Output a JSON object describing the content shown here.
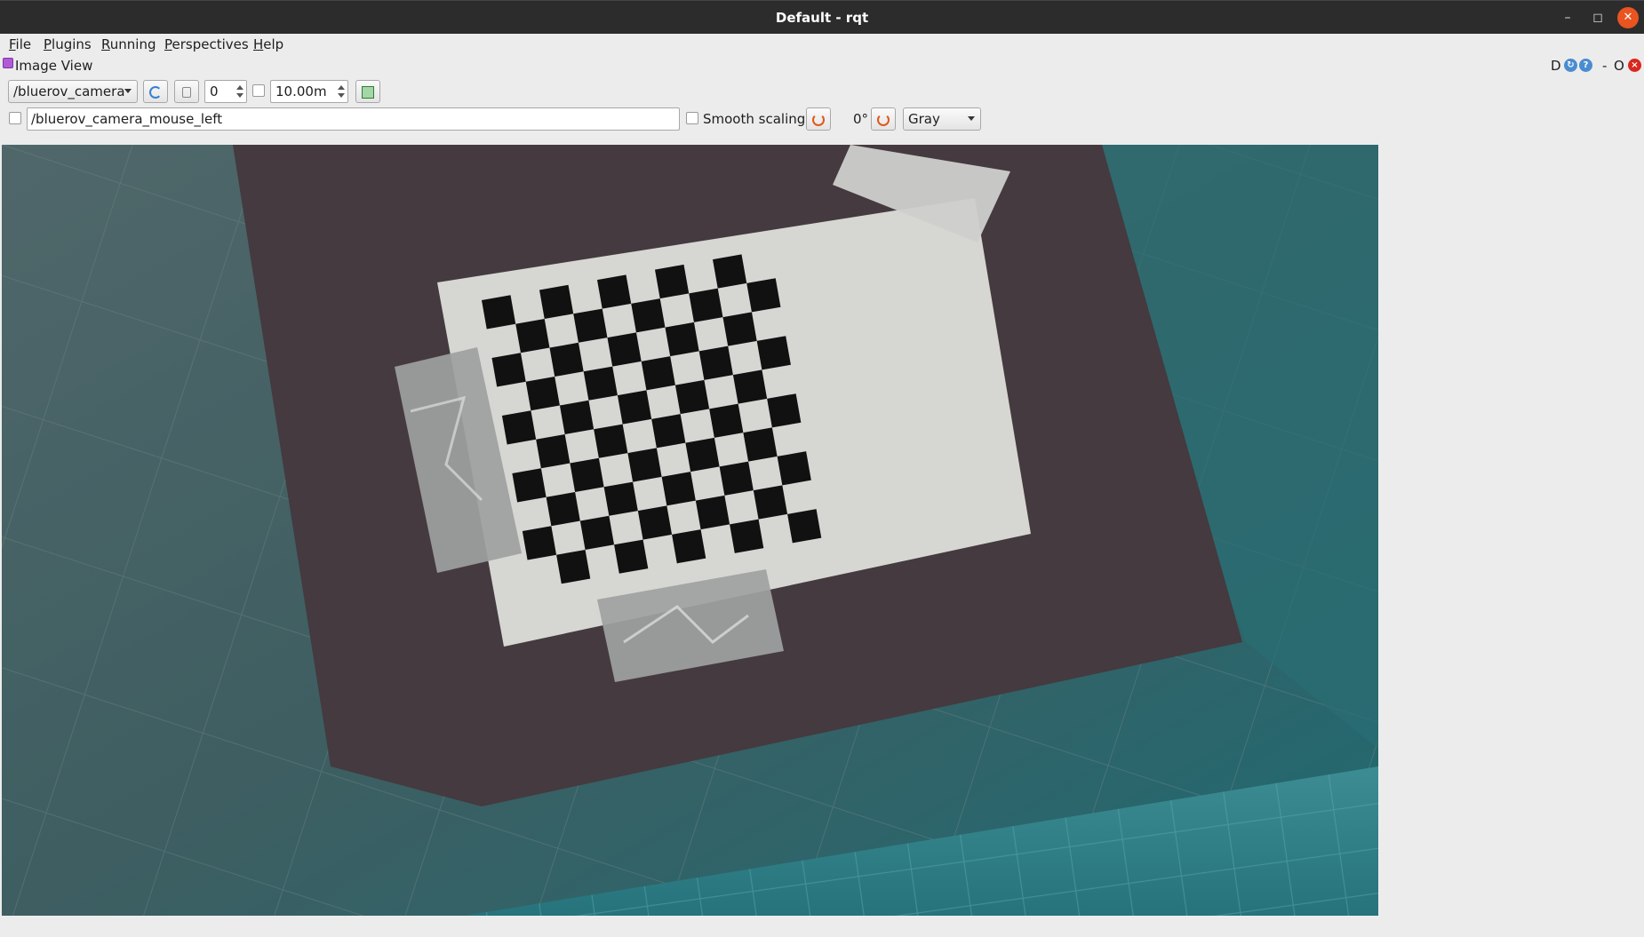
{
  "window": {
    "title": "Default - rqt",
    "minimize_icon": "minimize-icon",
    "maximize_icon": "restore-icon",
    "close_icon": "close-icon"
  },
  "menu": {
    "items": [
      {
        "mnemonic": "F",
        "rest": "ile"
      },
      {
        "mnemonic": "P",
        "rest": "lugins"
      },
      {
        "mnemonic": "R",
        "rest": "unning"
      },
      {
        "mnemonic": "P",
        "rest": "erspectives"
      },
      {
        "mnemonic": "H",
        "rest": "elp"
      }
    ]
  },
  "plugin": {
    "title": "Image View",
    "header_d": "D",
    "header_dash": "-",
    "header_o": "O",
    "help_glyph": "?",
    "close_glyph": "×"
  },
  "toolbar": {
    "topic": "/bluerov_camera",
    "spin_value": "0",
    "max_range": "10.00m",
    "mouse_topic": "/bluerov_camera_mouse_left",
    "smooth_scaling_label": "Smooth scaling",
    "rotation_label": "0°",
    "color_scheme": "Gray"
  },
  "image": {
    "description_icon": "camera-image"
  },
  "colors": {
    "titlebar": "#2c2c2c",
    "close_accent": "#e95420",
    "panel_bg": "#ececec",
    "water": "#3a6f74"
  }
}
